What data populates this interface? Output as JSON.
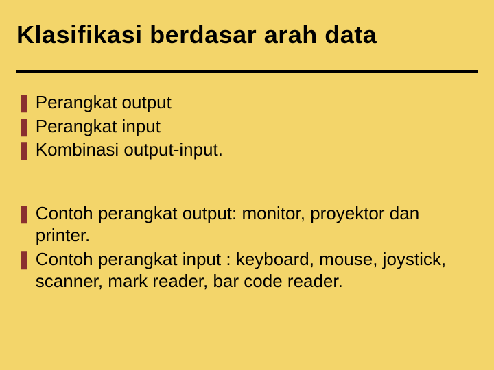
{
  "title": "Klasifikasi berdasar arah data",
  "bullet_glyph": "❚",
  "blocks": [
    {
      "items": [
        "Perangkat output",
        "Perangkat input",
        "Kombinasi output-input."
      ]
    },
    {
      "items": [
        "Contoh perangkat output: monitor, proyektor dan printer.",
        "Contoh perangkat input : keyboard, mouse, joystick, scanner, mark reader, bar code reader."
      ]
    }
  ]
}
